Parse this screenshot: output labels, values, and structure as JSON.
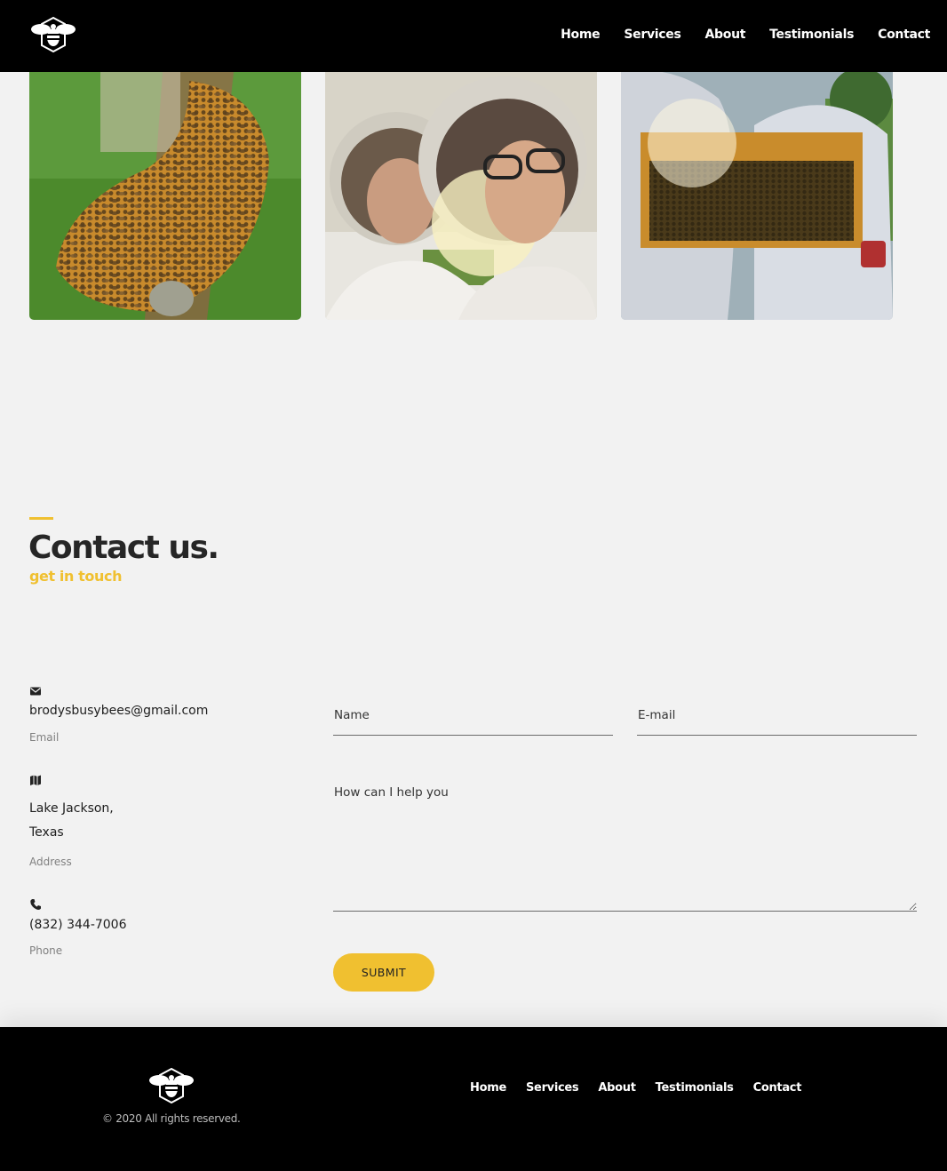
{
  "header": {
    "logo_icon": "bee-logo-icon",
    "nav": [
      "Home",
      "Services",
      "About",
      "Testimonials",
      "Contact"
    ]
  },
  "gallery": {
    "photos": [
      "honeycomb-with-bees",
      "two-beekeepers-selfie",
      "beekeepers-holding-frame"
    ]
  },
  "contact": {
    "title": "Contact us.",
    "subtitle": "get in touch",
    "email": {
      "icon": "envelope-icon",
      "value": "brodysbusybees@gmail.com",
      "label": "Email"
    },
    "address": {
      "icon": "map-icon",
      "line1": "Lake Jackson,",
      "line2": "Texas",
      "label": "Address"
    },
    "phone": {
      "icon": "phone-icon",
      "value": "(832) 344-7006",
      "label": "Phone"
    }
  },
  "form": {
    "name_placeholder": "Name",
    "email_placeholder": "E-mail",
    "message_placeholder": "How can I help you",
    "submit_label": "SUBMIT"
  },
  "footer": {
    "logo_icon": "bee-logo-icon",
    "copyright": "© 2020 All rights reserved.",
    "nav": [
      "Home",
      "Services",
      "About",
      "Testimonials",
      "Contact"
    ]
  },
  "colors": {
    "accent": "#f0c030",
    "header_bg": "#000000",
    "page_bg": "#f2f2f2"
  }
}
